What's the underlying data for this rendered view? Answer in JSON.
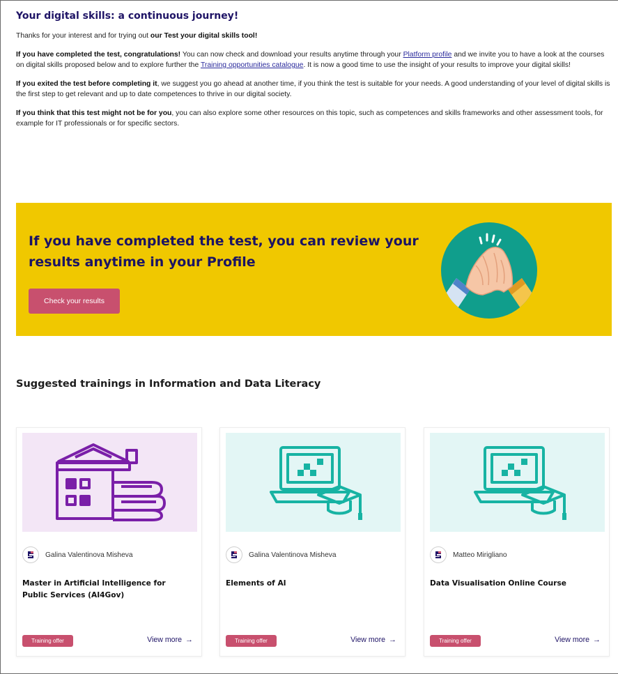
{
  "intro": {
    "heading": "Your digital skills: a continuous journey!",
    "p1_prefix": "Thanks for your interest and for trying out ",
    "p1_bold": "our Test your digital skills tool!",
    "p2_bold": "If you have completed the test, congratulations!",
    "p2_a": " You can now check and download your results anytime through your ",
    "p2_link1": "Platform profile",
    "p2_b": " and we invite you to have a look at the courses on digital skills proposed below and to explore further the ",
    "p2_link2": "Training opportunities catalogue",
    "p2_c": ". It is now a good time to use the insight of your results to improve your digital skills!",
    "p3_bold": "If you exited the test before completing it",
    "p3_rest": ", we suggest you go ahead at another time, if you think the test is suitable for your needs. A good understanding of your level of digital skills is the first step to get relevant and up to date competences to thrive in our digital society.",
    "p4_bold": "If you think that this test might not be for you",
    "p4_rest": ", you can also explore some other resources on this topic, such as competences and skills frameworks and other assessment tools, for example for IT professionals or for specific sectors."
  },
  "banner": {
    "heading": "If you have completed the test, you can review your results anytime in your Profile",
    "button_label": "Check your results"
  },
  "section": {
    "title": "Suggested trainings in Information and Data Literacy"
  },
  "cards": [
    {
      "author": "Galina Valentinova Misheva",
      "title": "Master in Artificial Intelligence for Public Services (AI4Gov)",
      "tag": "Training offer",
      "more": "View more",
      "arrow": "→"
    },
    {
      "author": "Galina Valentinova Misheva",
      "title": "Elements of AI",
      "tag": "Training offer",
      "more": "View more",
      "arrow": "→"
    },
    {
      "author": "Matteo Mirigliano",
      "title": "Data Visualisation Online Course",
      "tag": "Training offer",
      "more": "View more",
      "arrow": "→"
    }
  ],
  "colors": {
    "brand_navy": "#1f1466",
    "accent_pink": "#c8506e",
    "banner_yellow": "#f0c800",
    "circle_teal": "#109e8c",
    "thumb_lavender": "#f3e6f6",
    "thumb_mint": "#e3f6f5",
    "icon_purple": "#7a1fa8",
    "icon_teal": "#17b3a3"
  },
  "icons": {
    "banner": "handshake-high-five-icon",
    "card1": "library-building-books-icon",
    "card2": "laptop-graduation-cap-icon",
    "card3": "laptop-graduation-cap-icon",
    "avatar": "platform-logo-icon"
  }
}
